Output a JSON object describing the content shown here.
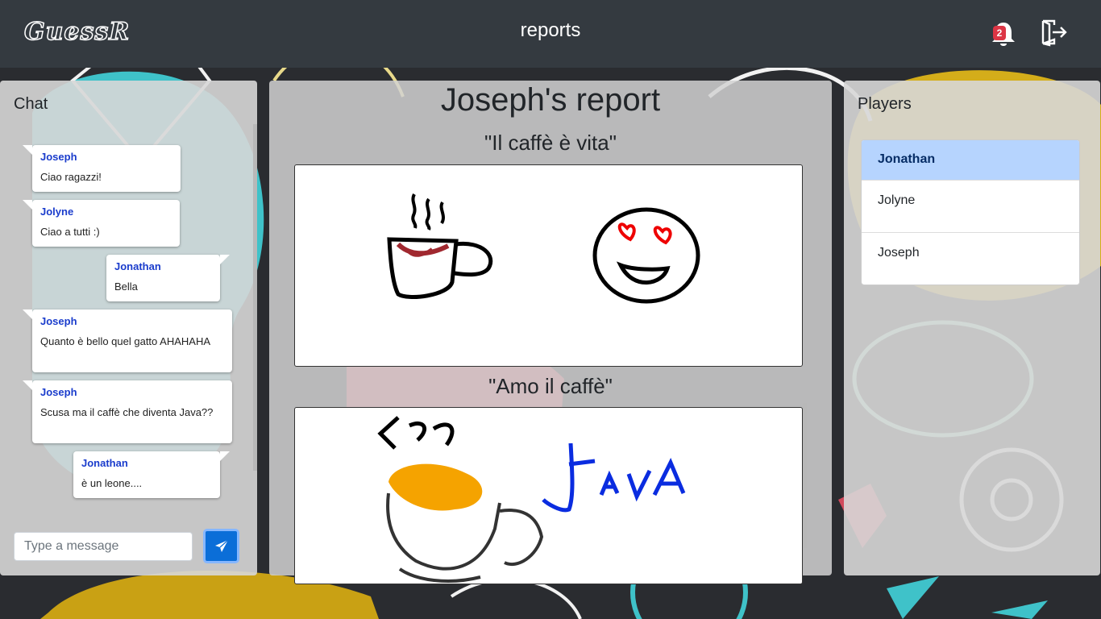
{
  "header": {
    "logo_text": "GuessR",
    "page_title": "reports",
    "notification_count": "2",
    "bell_icon": "bell-icon",
    "logout_icon": "logout-door-icon"
  },
  "chat": {
    "heading": "Chat",
    "messages": [
      {
        "author": "Joseph",
        "text": "Ciao ragazzi!"
      },
      {
        "author": "Jolyne",
        "text": "Ciao a tutti :)"
      },
      {
        "author": "Jonathan",
        "text": "Bella"
      },
      {
        "author": "Joseph",
        "text": "Quanto è bello quel gatto AHAHAHA"
      },
      {
        "author": "Joseph",
        "text": "Scusa ma il caffè che diventa Java??"
      },
      {
        "author": "Jonathan",
        "text": "è un leone...."
      }
    ],
    "input_placeholder": "Type a message",
    "send_icon": "paper-plane-icon"
  },
  "report": {
    "title": "Joseph's report",
    "drawings": [
      {
        "caption": "\"Il caffè è vita\""
      },
      {
        "caption": "\"Amo il caffè\"",
        "drawn_text": "Java"
      }
    ]
  },
  "players": {
    "heading": "Players",
    "items": [
      "Jonathan",
      "Jolyne",
      "Joseph"
    ],
    "selected": "Jonathan"
  },
  "colors": {
    "header_bg": "#343a40",
    "accent_blue": "#0b6ed8",
    "chat_author": "#1a3ccc",
    "selected_player_bg": "#b6d4fe",
    "badge_red": "#dc3545"
  }
}
